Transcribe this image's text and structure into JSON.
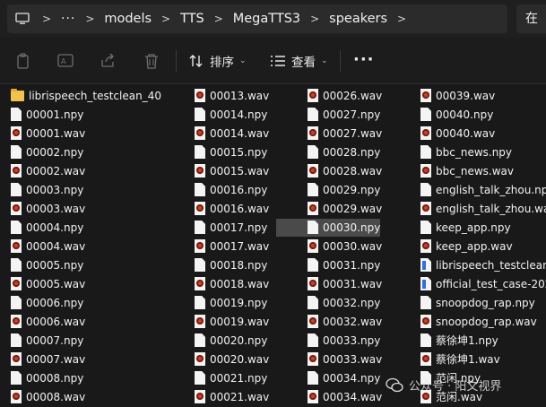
{
  "breadcrumb": {
    "ellipsis": "···",
    "items": [
      "models",
      "TTS",
      "MegaTTS3",
      "speakers"
    ],
    "search_stub": "在"
  },
  "toolbar": {
    "sort_label": "排序",
    "view_label": "查看",
    "more_label": "···"
  },
  "files": {
    "columns": [
      [
        {
          "name": "librispeech_testclean_40",
          "type": "folder"
        },
        {
          "name": "00001.npy",
          "type": "npy"
        },
        {
          "name": "00001.wav",
          "type": "wav"
        },
        {
          "name": "00002.npy",
          "type": "npy"
        },
        {
          "name": "00002.wav",
          "type": "wav"
        },
        {
          "name": "00003.npy",
          "type": "npy"
        },
        {
          "name": "00003.wav",
          "type": "wav"
        },
        {
          "name": "00004.npy",
          "type": "npy"
        },
        {
          "name": "00004.wav",
          "type": "wav"
        },
        {
          "name": "00005.npy",
          "type": "npy"
        },
        {
          "name": "00005.wav",
          "type": "wav"
        },
        {
          "name": "00006.npy",
          "type": "npy"
        },
        {
          "name": "00006.wav",
          "type": "wav"
        },
        {
          "name": "00007.npy",
          "type": "npy"
        },
        {
          "name": "00007.wav",
          "type": "wav"
        },
        {
          "name": "00008.npy",
          "type": "npy"
        },
        {
          "name": "00008.wav",
          "type": "wav"
        }
      ],
      [
        {
          "name": "00013.wav",
          "type": "wav"
        },
        {
          "name": "00014.npy",
          "type": "npy"
        },
        {
          "name": "00014.wav",
          "type": "wav"
        },
        {
          "name": "00015.npy",
          "type": "npy"
        },
        {
          "name": "00015.wav",
          "type": "wav"
        },
        {
          "name": "00016.npy",
          "type": "npy"
        },
        {
          "name": "00016.wav",
          "type": "wav"
        },
        {
          "name": "00017.npy",
          "type": "npy"
        },
        {
          "name": "00017.wav",
          "type": "wav"
        },
        {
          "name": "00018.npy",
          "type": "npy"
        },
        {
          "name": "00018.wav",
          "type": "wav"
        },
        {
          "name": "00019.npy",
          "type": "npy"
        },
        {
          "name": "00019.wav",
          "type": "wav"
        },
        {
          "name": "00020.npy",
          "type": "npy"
        },
        {
          "name": "00020.wav",
          "type": "wav"
        },
        {
          "name": "00021.npy",
          "type": "npy"
        },
        {
          "name": "00021.wav",
          "type": "wav"
        }
      ],
      [
        {
          "name": "00026.wav",
          "type": "wav"
        },
        {
          "name": "00027.npy",
          "type": "npy"
        },
        {
          "name": "00027.wav",
          "type": "wav"
        },
        {
          "name": "00028.npy",
          "type": "npy"
        },
        {
          "name": "00028.wav",
          "type": "wav"
        },
        {
          "name": "00029.npy",
          "type": "npy"
        },
        {
          "name": "00029.wav",
          "type": "wav"
        },
        {
          "name": "00030.npy",
          "type": "npy",
          "selected": true
        },
        {
          "name": "00030.wav",
          "type": "wav"
        },
        {
          "name": "00031.npy",
          "type": "npy"
        },
        {
          "name": "00031.wav",
          "type": "wav"
        },
        {
          "name": "00032.npy",
          "type": "npy"
        },
        {
          "name": "00032.wav",
          "type": "wav"
        },
        {
          "name": "00033.npy",
          "type": "npy"
        },
        {
          "name": "00033.wav",
          "type": "wav"
        },
        {
          "name": "00034.npy",
          "type": "npy"
        },
        {
          "name": "00034.wav",
          "type": "wav"
        }
      ],
      [
        {
          "name": "00039.wav",
          "type": "wav"
        },
        {
          "name": "00040.npy",
          "type": "npy"
        },
        {
          "name": "00040.wav",
          "type": "wav"
        },
        {
          "name": "bbc_news.npy",
          "type": "npy"
        },
        {
          "name": "bbc_news.wav",
          "type": "wav"
        },
        {
          "name": "english_talk_zhou.npy",
          "type": "npy"
        },
        {
          "name": "english_talk_zhou.wav",
          "type": "wav"
        },
        {
          "name": "keep_app.npy",
          "type": "npy"
        },
        {
          "name": "keep_app.wav",
          "type": "wav"
        },
        {
          "name": "librispeech_testclean_",
          "type": "doc-blue"
        },
        {
          "name": "official_test_case-2025",
          "type": "doc-blue"
        },
        {
          "name": "snoopdog_rap.npy",
          "type": "npy"
        },
        {
          "name": "snoopdog_rap.wav",
          "type": "wav"
        },
        {
          "name": "蔡徐坤1.npy",
          "type": "npy"
        },
        {
          "name": "蔡徐坤1.wav",
          "type": "wav"
        },
        {
          "name": "范闲.npy",
          "type": "npy"
        },
        {
          "name": "范闲.wav",
          "type": "wav"
        }
      ]
    ]
  },
  "watermark": {
    "text": "公众号 · 阳文视界"
  }
}
